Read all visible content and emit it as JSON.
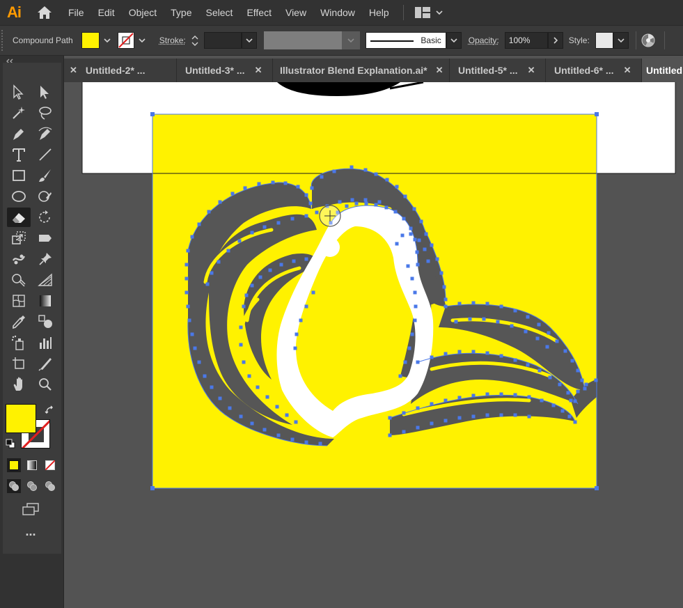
{
  "app": {
    "logo": "Ai"
  },
  "menu": [
    "File",
    "Edit",
    "Object",
    "Type",
    "Select",
    "Effect",
    "View",
    "Window",
    "Help"
  ],
  "control": {
    "selection_type": "Compound Path",
    "stroke_label": "Stroke:",
    "stroke_style": "Basic",
    "opacity_label": "Opacity:",
    "opacity_value": "100%",
    "style_label": "Style:",
    "fill_color": "#fff200"
  },
  "tabs": [
    {
      "label": "Untitled-2* ...",
      "active": false
    },
    {
      "label": "Untitled-3* ...",
      "active": false
    },
    {
      "label": "Illustrator Blend Explanation.ai*",
      "active": false
    },
    {
      "label": "Untitled-5* ...",
      "active": false
    },
    {
      "label": "Untitled-6* ...",
      "active": false
    },
    {
      "label": "Untitled",
      "active": true
    }
  ],
  "toolbar": {
    "more_label": "...",
    "tools": [
      "direct-selection-icon",
      "selection-icon",
      "magic-wand-icon",
      "lasso-icon",
      "pen-icon",
      "curvature-icon",
      "type-icon",
      "line-segment-icon",
      "rectangle-icon",
      "paintbrush-icon",
      "ellipse-icon",
      "shaper-icon",
      "eraser-icon",
      "rotate-icon",
      "scale-icon",
      "width-icon",
      "puppet-warp-icon",
      "pin-icon",
      "shape-builder-icon",
      "perspective-grid-icon",
      "mesh-icon",
      "gradient-icon",
      "eyedropper-icon",
      "blend-icon",
      "symbol-sprayer-icon",
      "column-graph-icon",
      "artboard-icon",
      "slice-icon",
      "hand-icon",
      "zoom-icon"
    ],
    "selected_tool": "eraser-icon"
  },
  "colors": {
    "fill": "#fff200",
    "shape_gray": "#565656",
    "eraser_path": "#ffffff",
    "anchor": "#4a78e8"
  }
}
